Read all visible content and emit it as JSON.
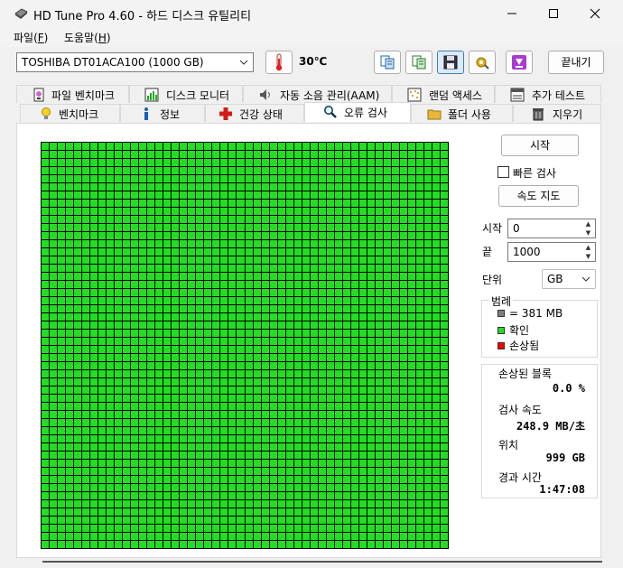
{
  "window": {
    "title": "HD Tune Pro 4.60 - 하드 디스크 유틸리티",
    "minimize_icon": "minimize-icon",
    "maximize_icon": "maximize-icon",
    "close_icon": "close-icon"
  },
  "menu": {
    "file_text": "파일(",
    "file_key": "F",
    "file_end": ")",
    "help_text": "도움말(",
    "help_key": "H",
    "help_end": ")"
  },
  "toolbar": {
    "drive": "TOSHIBA DT01ACA100 (1000 GB)",
    "temperature": "30℃",
    "exit_label": "끝내기",
    "icons": [
      "thermometer-icon",
      "copy-icon",
      "copy-info-icon",
      "save-icon",
      "settings-icon",
      "download-icon"
    ]
  },
  "tabs": {
    "row1": [
      "파일 벤치마크",
      "디스크 모니터",
      "자동 소음 관리(AAM)",
      "랜덤 액세스",
      "추가 테스트"
    ],
    "row2": [
      "벤치마크",
      "정보",
      "건강 상태",
      "오류 검사",
      "폴더 사용",
      "지우기"
    ],
    "active": "오류 검사"
  },
  "controls": {
    "start_label": "시작",
    "quick_scan_label": "빠른 검사",
    "speed_map_label": "속도 지도",
    "start_field_label": "시작",
    "start_value": "0",
    "end_field_label": "끝",
    "end_value": "1000",
    "unit_label": "단위",
    "unit_value": "GB",
    "quick_scan_checked": false
  },
  "legend": {
    "title": "범례",
    "items": [
      {
        "label": "= 381 MB",
        "color": "#808080"
      },
      {
        "label": "확인",
        "color": "#22dd22"
      },
      {
        "label": "손상됨",
        "color": "#ff0000"
      }
    ]
  },
  "stats": {
    "damaged_blocks_label": "손상된 블록",
    "damaged_blocks_value": "0.0 %",
    "scan_speed_label": "검사 속도",
    "scan_speed_value": "248.9 MB/초",
    "position_label": "위치",
    "position_value": "999 GB",
    "elapsed_label": "경과 시간",
    "elapsed_value": "1:47:08"
  },
  "scan_map": {
    "rows": 50,
    "cols": 50,
    "ok_color": "#22dd22",
    "grid_color": "#000000"
  },
  "colors": {
    "accent": "#22dd22",
    "damaged": "#ff0000"
  }
}
